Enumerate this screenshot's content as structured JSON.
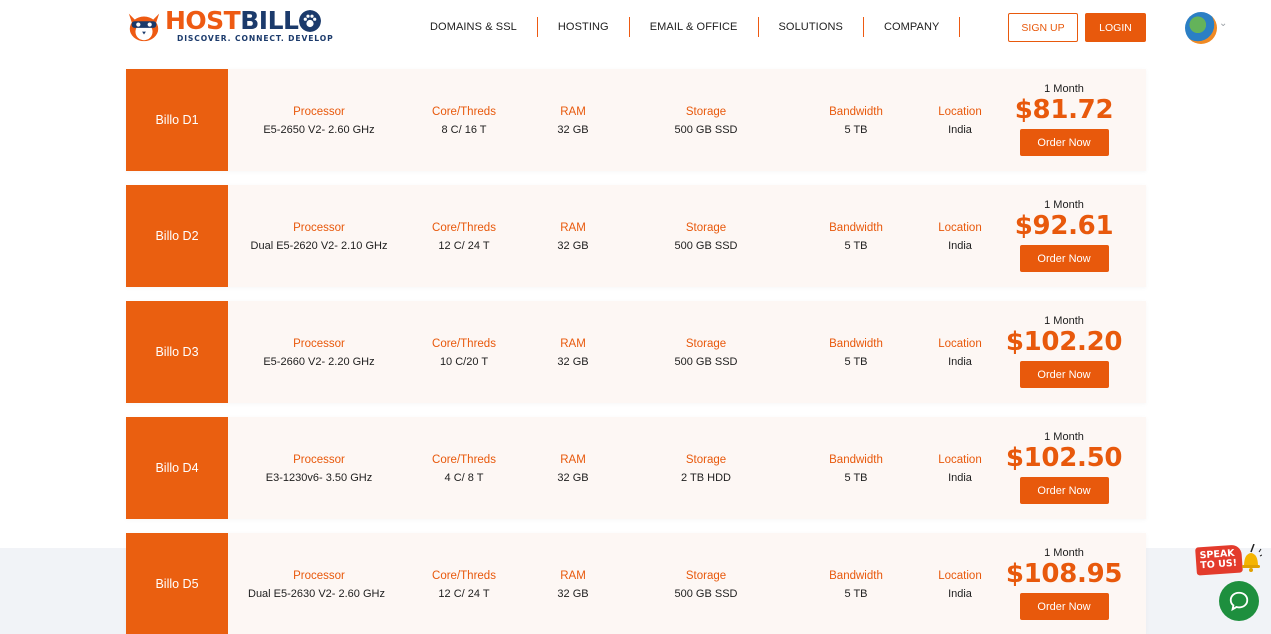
{
  "brand": {
    "logo_host": "HOST",
    "logo_billo": "BILL",
    "tagline": "DISCOVER. CONNECT. DEVELOP",
    "accent": "#e8590c",
    "navy": "#1b3a6b"
  },
  "nav": {
    "items": [
      "DOMAINS & SSL",
      "HOSTING",
      "EMAIL & OFFICE",
      "SOLUTIONS",
      "COMPANY"
    ]
  },
  "auth": {
    "signup": "SIGN UP",
    "login": "LOGIN"
  },
  "icons": {
    "language": "globe-icon",
    "caret": "chevron-down-icon",
    "chat": "chat-icon",
    "bell": "bell-icon"
  },
  "labels": {
    "processor": "Processor",
    "cores": "Core/Threds",
    "ram": "RAM",
    "storage": "Storage",
    "bandwidth": "Bandwidth",
    "location": "Location",
    "term": "1 Month",
    "order": "Order Now"
  },
  "plans": [
    {
      "name": "Billo D1",
      "processor": "E5-2650 V2- 2.60 GHz",
      "cores": "8 C/ 16 T",
      "ram": "32 GB",
      "storage": "500 GB SSD",
      "bandwidth": "5 TB",
      "location": "India",
      "price": "$81.72"
    },
    {
      "name": "Billo D2",
      "processor": "Dual E5-2620 V2- 2.10 GHz",
      "cores": "12 C/ 24 T",
      "ram": "32 GB",
      "storage": "500 GB SSD",
      "bandwidth": "5 TB",
      "location": "India",
      "price": "$92.61"
    },
    {
      "name": "Billo D3",
      "processor": "E5-2660 V2- 2.20 GHz",
      "cores": "10 C/20 T",
      "ram": "32 GB",
      "storage": "500 GB SSD",
      "bandwidth": "5 TB",
      "location": "India",
      "price": "$102.20"
    },
    {
      "name": "Billo D4",
      "processor": "E3-1230v6- 3.50 GHz",
      "cores": "4 C/ 8 T",
      "ram": "32 GB",
      "storage": "2 TB HDD",
      "bandwidth": "5 TB",
      "location": "India",
      "price": "$102.50"
    },
    {
      "name": "Billo D5",
      "processor": "Dual E5-2630 V2- 2.60 GHz",
      "cores": "12 C/ 24 T",
      "ram": "32 GB",
      "storage": "500 GB SSD",
      "bandwidth": "5 TB",
      "location": "India",
      "price": "$108.95"
    }
  ],
  "widgets": {
    "speak_line1": "SPEAK",
    "speak_line2": "TO US!"
  }
}
